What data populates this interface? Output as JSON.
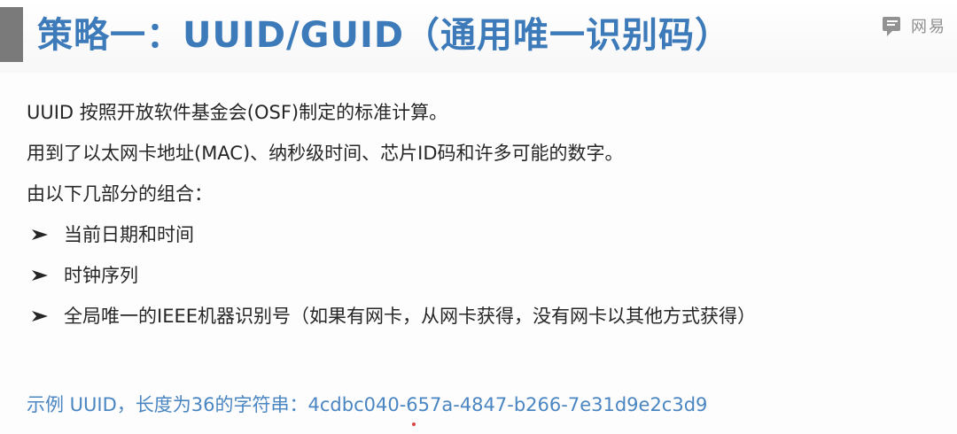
{
  "header": {
    "title": "策略一：UUID/GUID（通用唯一识别码）",
    "logo_text": "网易"
  },
  "body": {
    "lines": [
      "UUID 按照开放软件基金会(OSF)制定的标准计算。",
      "用到了以太网卡地址(MAC)、纳秒级时间、芯片ID码和许多可能的数字。",
      "由以下几部分的组合："
    ],
    "bullets": [
      "当前日期和时间",
      "时钟序列",
      "全局唯一的IEEE机器识别号（如果有网卡，从网卡获得，没有网卡以其他方式获得）"
    ]
  },
  "example": {
    "label": "示例 UUID，长度为36的字符串：",
    "value": "4cdbc040-657a-4847-b266-7e31d9e2c3d9"
  },
  "colors": {
    "title": "#3d7ab9",
    "example": "#4a86c2",
    "body_text": "#262626",
    "accent_bar": "#7a7a7a"
  },
  "icons": {
    "logo": "chat-bubble-icon",
    "bullet": "arrowhead-bullet-icon"
  }
}
